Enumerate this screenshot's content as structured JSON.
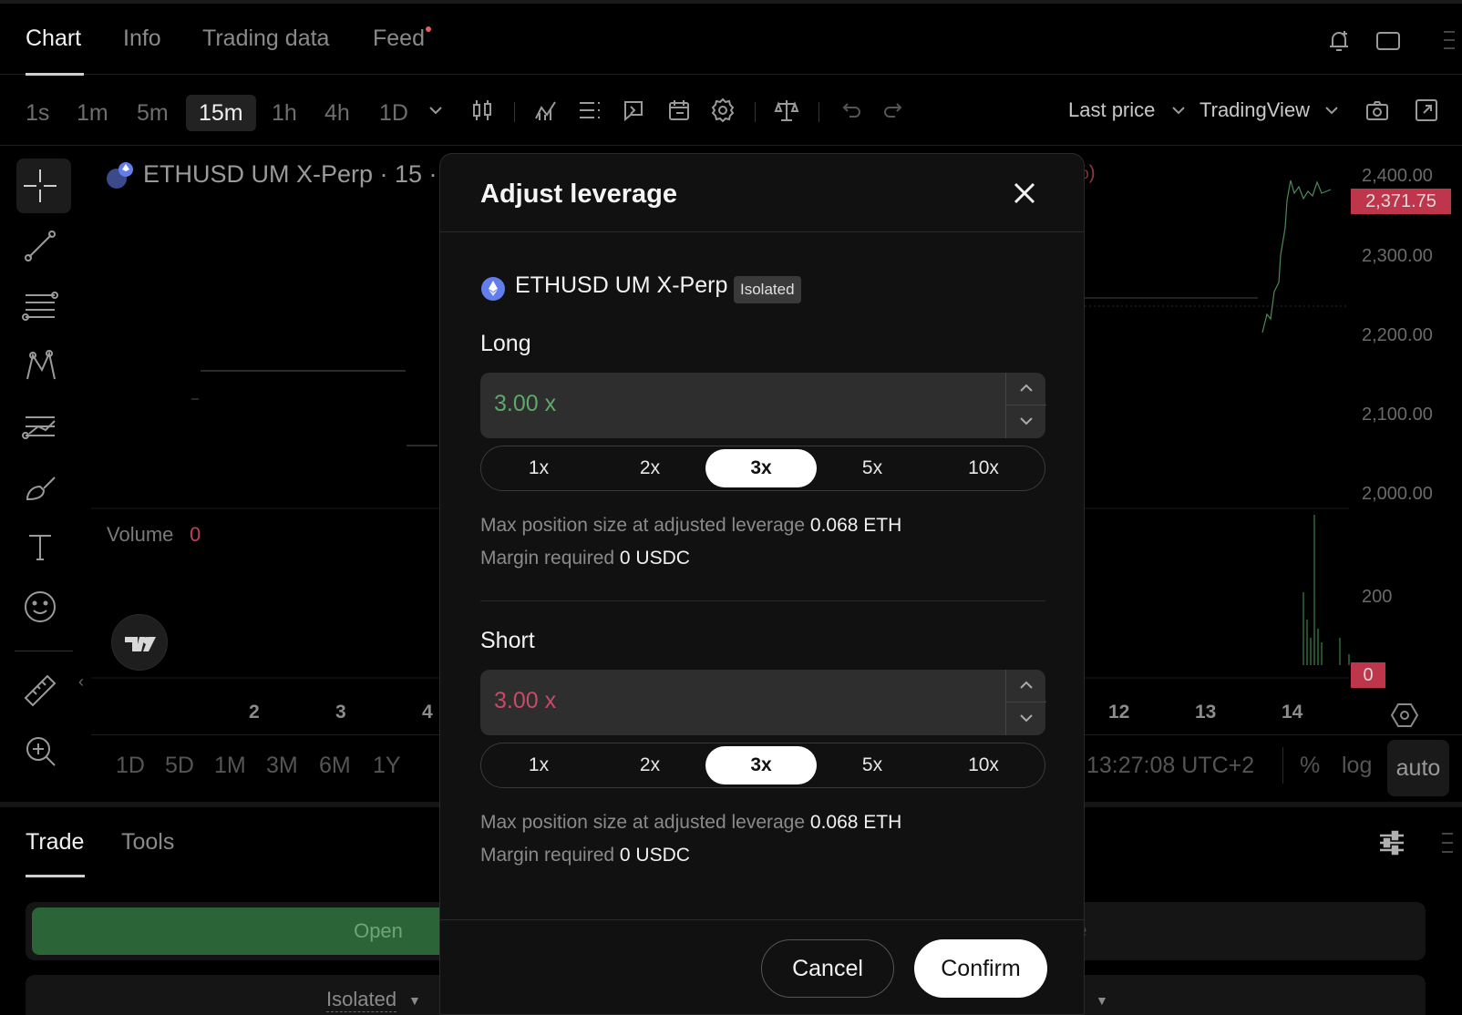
{
  "top_tabs": [
    {
      "label": "Chart",
      "active": true
    },
    {
      "label": "Info"
    },
    {
      "label": "Trading data"
    },
    {
      "label": "Feed"
    }
  ],
  "toolbar": {
    "timeframes": [
      "1s",
      "1m",
      "5m",
      "15m",
      "1h",
      "4h",
      "1D"
    ],
    "active_timeframe": "15m",
    "price_source": "Last price",
    "chart_engine": "TradingView"
  },
  "chart": {
    "symbol_title": "ETHUSD UM X-Perp · 15 ·",
    "header_fragment": "%)",
    "y_labels": [
      "2,400.00",
      "2,300.00",
      "2,200.00",
      "2,100.00",
      "2,000.00"
    ],
    "last_price": "2,371.75",
    "volume_label": "Volume",
    "volume_value": "0",
    "volume_axis": "200",
    "volume_last": "0",
    "x_labels": [
      "2",
      "3",
      "4",
      "12",
      "13",
      "14"
    ],
    "ranges": [
      "1D",
      "5D",
      "1M",
      "3M",
      "6M",
      "1Y"
    ],
    "clock": "13:27:08 UTC+2",
    "scale_options": [
      "%",
      "log",
      "auto"
    ]
  },
  "bottom": {
    "tabs": [
      "Trade",
      "Tools"
    ],
    "open_label": "Open",
    "close_fragment": "e",
    "margin_mode": "Isolated"
  },
  "modal": {
    "title": "Adjust leverage",
    "asset": "ETHUSD UM X-Perp",
    "margin_badge": "Isolated",
    "long": {
      "label": "Long",
      "value": "3.00 x",
      "presets": [
        "1x",
        "2x",
        "3x",
        "5x",
        "10x"
      ],
      "selected": "3x",
      "max_label": "Max position size at adjusted leverage",
      "max_value": "0.068 ETH",
      "margin_label": "Margin required",
      "margin_value": "0 USDC"
    },
    "short": {
      "label": "Short",
      "value": "3.00 x",
      "presets": [
        "1x",
        "2x",
        "3x",
        "5x",
        "10x"
      ],
      "selected": "3x",
      "max_label": "Max position size at adjusted leverage",
      "max_value": "0.068 ETH",
      "margin_label": "Margin required",
      "margin_value": "0 USDC"
    },
    "cancel_label": "Cancel",
    "confirm_label": "Confirm"
  },
  "colors": {
    "long_green": "#5fa86a",
    "short_red": "#c64a6a",
    "price_tag": "#e0405a",
    "eth_blue": "#627eea"
  }
}
